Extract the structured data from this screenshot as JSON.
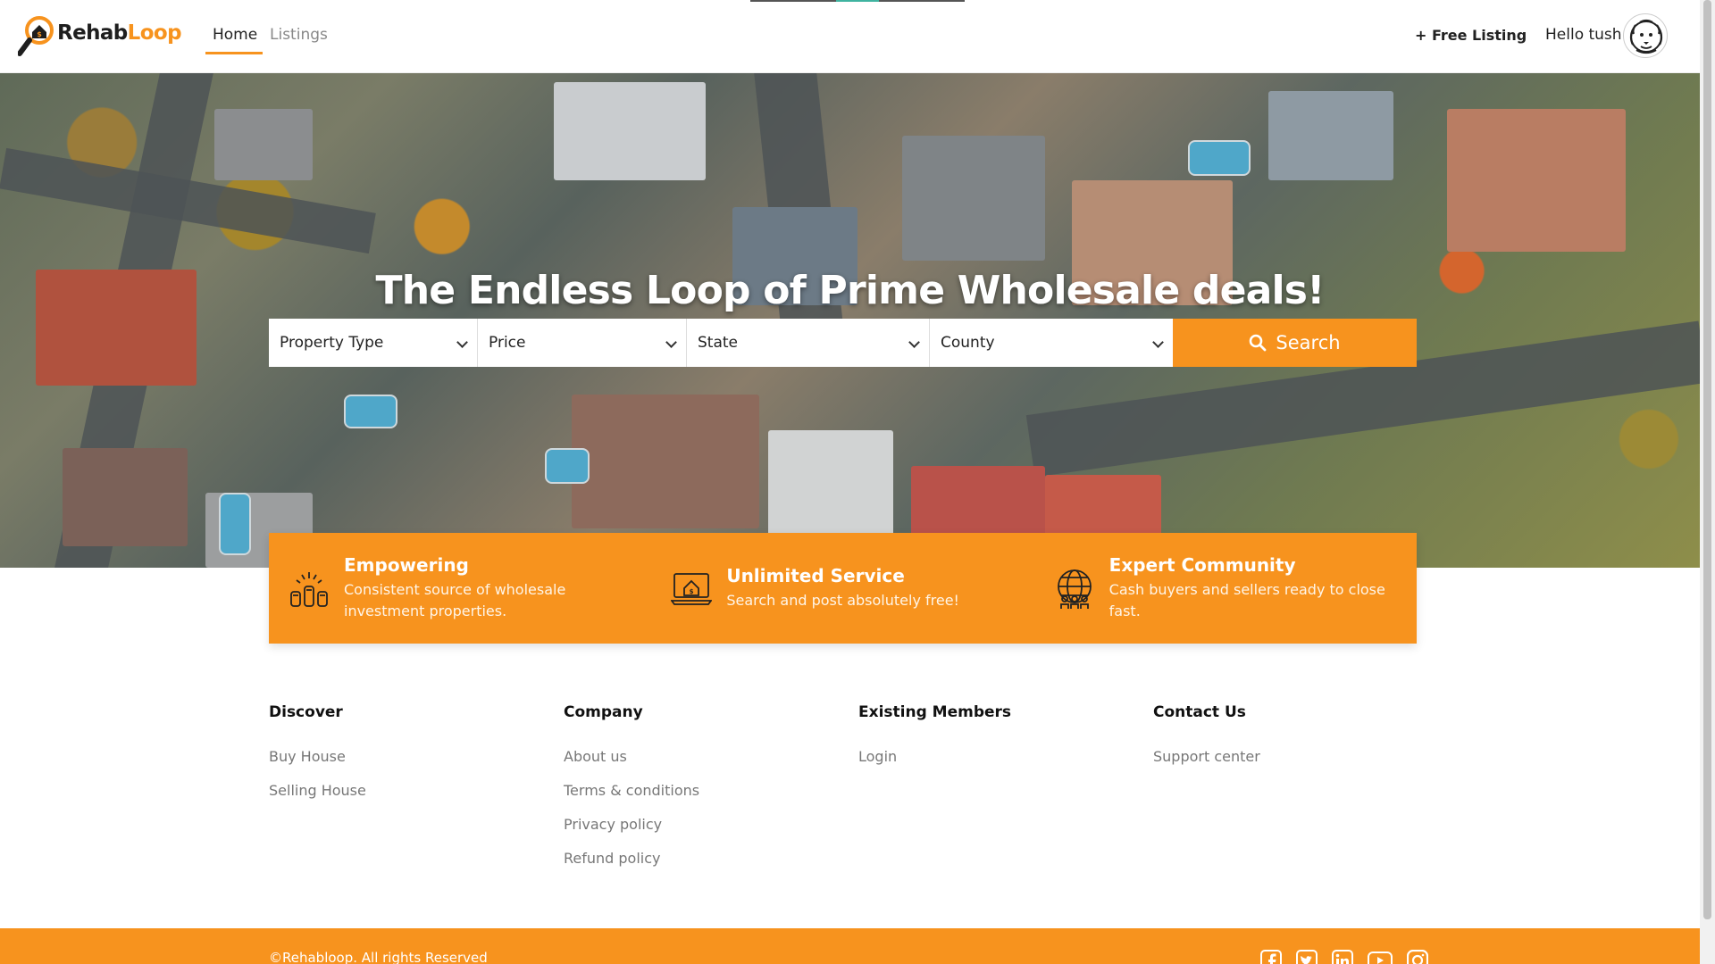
{
  "header": {
    "logo": {
      "part1": "Rehab",
      "part2": "Loop"
    },
    "nav": [
      {
        "label": "Home",
        "active": true
      },
      {
        "label": "Listings",
        "active": false
      }
    ],
    "free_listing": "+ Free Listing",
    "greeting": "Hello tush",
    "avatar_icon": "lion-avatar-icon"
  },
  "hero": {
    "title": "The Endless Loop of Prime Wholesale deals!"
  },
  "search": {
    "property_type": "Property Type",
    "price": "Price",
    "state": "State",
    "county": "County",
    "button": "Search"
  },
  "features": [
    {
      "icon": "raised-fists-icon",
      "title": "Empowering",
      "description": "Consistent source of wholesale investment properties."
    },
    {
      "icon": "laptop-house-icon",
      "title": "Unlimited Service",
      "description": "Search and post absolutely free!"
    },
    {
      "icon": "globe-people-icon",
      "title": "Expert Community",
      "description": "Cash buyers and sellers ready to close fast."
    }
  ],
  "footer": {
    "columns": [
      {
        "heading": "Discover",
        "links": [
          "Buy House",
          "Selling House"
        ]
      },
      {
        "heading": "Company",
        "links": [
          "About us",
          "Terms & conditions",
          "Privacy policy",
          "Refund policy"
        ]
      },
      {
        "heading": "Existing Members",
        "links": [
          "Login"
        ]
      },
      {
        "heading": "Contact Us",
        "links": [
          "Support center"
        ]
      }
    ],
    "copyright": "©Rehabloop. All rights Reserved",
    "social": [
      "facebook-icon",
      "twitter-icon",
      "linkedin-icon",
      "youtube-icon",
      "instagram-icon"
    ]
  },
  "colors": {
    "accent": "#f7931e",
    "text_dark": "#222222",
    "text_muted": "#777777"
  }
}
